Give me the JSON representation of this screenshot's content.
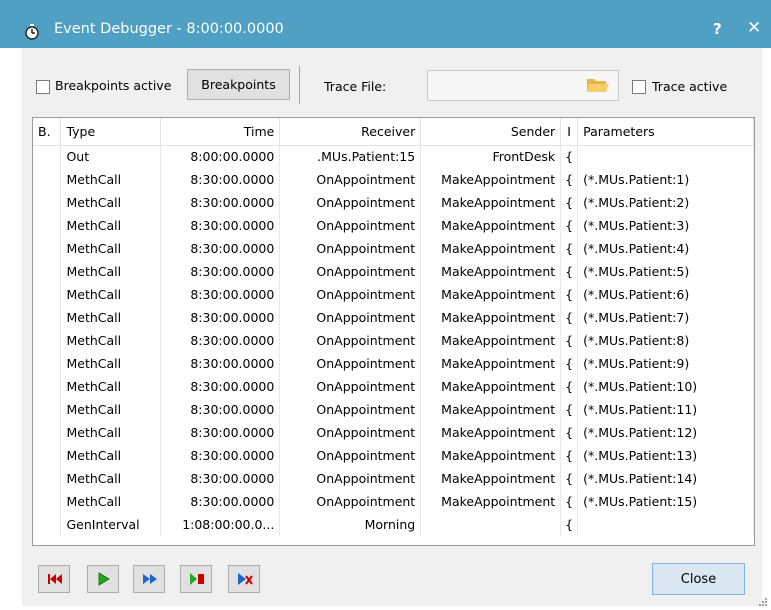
{
  "window": {
    "title": "Event Debugger - 8:00:00.0000",
    "help_label": "?",
    "close_label": "✕"
  },
  "toolbar": {
    "breakpoints_active_label": "Breakpoints active",
    "breakpoints_active_checked": false,
    "breakpoints_button_label": "Breakpoints",
    "trace_file_label": "Trace File:",
    "trace_file_value": "",
    "trace_active_label": "Trace active",
    "trace_active_checked": false
  },
  "table": {
    "columns": [
      "B.",
      "Type",
      "Time",
      "Receiver",
      "Sender",
      "I",
      "Parameters"
    ],
    "rows": [
      [
        "",
        "Out",
        "8:00:00.0000",
        ".MUs.Patient:15",
        "FrontDesk",
        "{",
        ""
      ],
      [
        "",
        "MethCall",
        "8:30:00.0000",
        "OnAppointment",
        "MakeAppointment",
        "{",
        "(*.MUs.Patient:1)"
      ],
      [
        "",
        "MethCall",
        "8:30:00.0000",
        "OnAppointment",
        "MakeAppointment",
        "{",
        "(*.MUs.Patient:2)"
      ],
      [
        "",
        "MethCall",
        "8:30:00.0000",
        "OnAppointment",
        "MakeAppointment",
        "{",
        "(*.MUs.Patient:3)"
      ],
      [
        "",
        "MethCall",
        "8:30:00.0000",
        "OnAppointment",
        "MakeAppointment",
        "{",
        "(*.MUs.Patient:4)"
      ],
      [
        "",
        "MethCall",
        "8:30:00.0000",
        "OnAppointment",
        "MakeAppointment",
        "{",
        "(*.MUs.Patient:5)"
      ],
      [
        "",
        "MethCall",
        "8:30:00.0000",
        "OnAppointment",
        "MakeAppointment",
        "{",
        "(*.MUs.Patient:6)"
      ],
      [
        "",
        "MethCall",
        "8:30:00.0000",
        "OnAppointment",
        "MakeAppointment",
        "{",
        "(*.MUs.Patient:7)"
      ],
      [
        "",
        "MethCall",
        "8:30:00.0000",
        "OnAppointment",
        "MakeAppointment",
        "{",
        "(*.MUs.Patient:8)"
      ],
      [
        "",
        "MethCall",
        "8:30:00.0000",
        "OnAppointment",
        "MakeAppointment",
        "{",
        "(*.MUs.Patient:9)"
      ],
      [
        "",
        "MethCall",
        "8:30:00.0000",
        "OnAppointment",
        "MakeAppointment",
        "{",
        "(*.MUs.Patient:10)"
      ],
      [
        "",
        "MethCall",
        "8:30:00.0000",
        "OnAppointment",
        "MakeAppointment",
        "{",
        "(*.MUs.Patient:11)"
      ],
      [
        "",
        "MethCall",
        "8:30:00.0000",
        "OnAppointment",
        "MakeAppointment",
        "{",
        "(*.MUs.Patient:12)"
      ],
      [
        "",
        "MethCall",
        "8:30:00.0000",
        "OnAppointment",
        "MakeAppointment",
        "{",
        "(*.MUs.Patient:13)"
      ],
      [
        "",
        "MethCall",
        "8:30:00.0000",
        "OnAppointment",
        "MakeAppointment",
        "{",
        "(*.MUs.Patient:14)"
      ],
      [
        "",
        "MethCall",
        "8:30:00.0000",
        "OnAppointment",
        "MakeAppointment",
        "{",
        "(*.MUs.Patient:15)"
      ],
      [
        "",
        "GenInterval",
        "1:08:00:00.0...",
        "Morning",
        "",
        "{",
        ""
      ]
    ]
  },
  "controls": {
    "buttons": [
      {
        "name": "reset-button",
        "icon": "reset-icon"
      },
      {
        "name": "start-button",
        "icon": "play-icon"
      },
      {
        "name": "fast-forward-button",
        "icon": "fast-forward-icon"
      },
      {
        "name": "stop-button",
        "icon": "stop-icon"
      },
      {
        "name": "step-button",
        "icon": "step-icon"
      }
    ],
    "close_label": "Close"
  },
  "colors": {
    "titlebar": "#4fa0c2",
    "reset": "#cc0000",
    "play": "#22aa22",
    "fast_forward": "#1f66cc",
    "close_button_border": "#7eb4ea"
  }
}
